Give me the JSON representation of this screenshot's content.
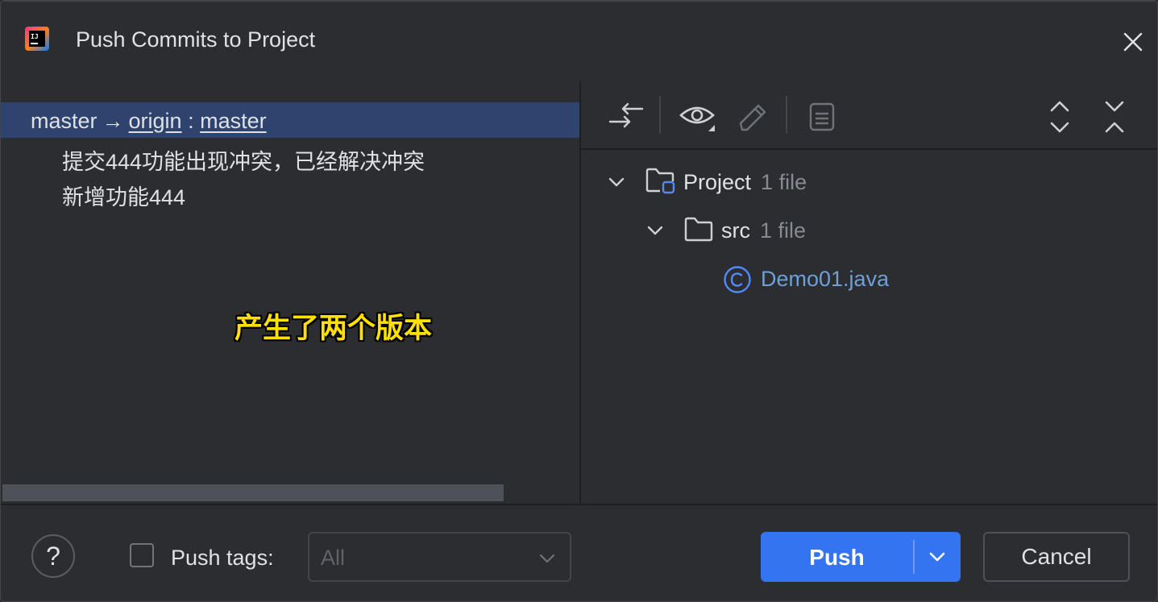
{
  "dialog": {
    "title": "Push Commits to Project"
  },
  "left": {
    "branch": {
      "local": "master",
      "arrow": "→",
      "remote": "origin",
      "colon": ":",
      "remote_branch": "master"
    },
    "commits": [
      "提交444功能出现冲突，已经解决冲突",
      "新增功能444"
    ],
    "caption": "产生了两个版本"
  },
  "right": {
    "toolbar": [
      "compare-arrows-icon",
      "eye-icon",
      "pencil-icon",
      "document-icon",
      "expand-all-icon",
      "collapse-all-icon"
    ],
    "tree": [
      {
        "name": "Project",
        "count": "1 file"
      },
      {
        "name": "src",
        "count": "1 file"
      },
      {
        "name": "Demo01.java"
      }
    ]
  },
  "footer": {
    "help": "?",
    "push_tags_label": "Push tags:",
    "push_tags_value": "All",
    "push_label": "Push",
    "cancel_label": "Cancel"
  },
  "colors": {
    "accent": "#3574f0",
    "selection": "#2e436e",
    "caption": "#ffe000",
    "file": "#6e9fd8"
  }
}
